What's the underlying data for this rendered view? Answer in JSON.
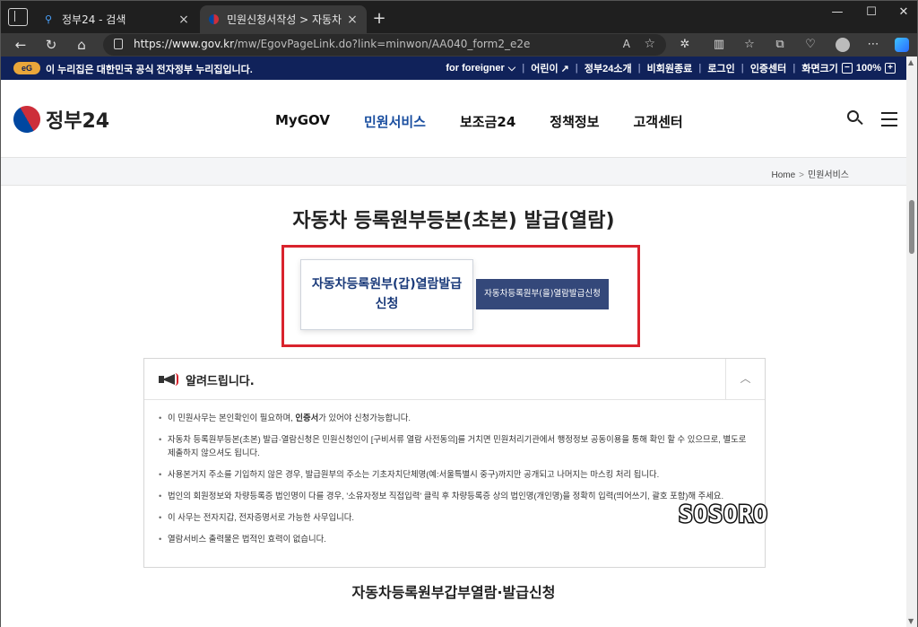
{
  "browser": {
    "tabs": [
      {
        "title": "정부24 - 검색",
        "favicon": "search-icon",
        "active": false
      },
      {
        "title": "민원신청서작성 > 자동차 등록원부",
        "favicon": "gov24-icon",
        "active": true
      }
    ],
    "new_tab": "+",
    "url_host": "https://www.gov.kr",
    "url_path": "/mw/EgovPageLink.do?link=minwon/AA040_form2_e2e",
    "read_aloud": "A",
    "window_controls": {
      "minimize": "—",
      "maximize": "☐",
      "close": "✕"
    }
  },
  "gov_banner": {
    "logo": "eG",
    "notice": "이 누리집은 대한민국 공식 전자정부 누리집입니다.",
    "links": [
      "for foreigner",
      "어린이",
      "정부24소개",
      "비회원종료",
      "로그인",
      "인증센터",
      "화면크기"
    ],
    "zoom": "100%",
    "zoom_minus": "−",
    "zoom_plus": "+"
  },
  "header": {
    "logo_text": "정부24",
    "nav": [
      "MyGOV",
      "민원서비스",
      "보조금24",
      "정책정보",
      "고객센터"
    ],
    "active_nav": "민원서비스"
  },
  "breadcrumb": {
    "home": "Home",
    "sep": ">",
    "current": "민원서비스"
  },
  "page": {
    "title": "자동차 등록원부등본(초본) 발급(열람)",
    "button_a": "자동차등록원부(갑)열람발급신청",
    "button_b": "자동차등록원부(을)열람발급신청"
  },
  "notice": {
    "title": "알려드립니다.",
    "collapse": "︿",
    "items": [
      {
        "pre": "이 민원사무는 본인확인이 필요하며, ",
        "bold": "인증서",
        "post": "가 있어야 신청가능합니다."
      },
      {
        "text": "자동차 등록원부등본(초본) 발급·열람신청은 민원신청인이 [구비서류 열람 사전동의]를 거치면 민원처리기관에서 행정정보 공동이용을 통해 확인 할 수 있으므로, 별도로 제출하지 않으셔도 됩니다."
      },
      {
        "text": "사용본거지 주소를 기입하지 않은 경우, 발급원부의 주소는 기초자치단체명(예:서울특별시 중구)까지만 공개되고 나머지는 마스킹 처리 됩니다."
      },
      {
        "text": "법인의 회원정보와 차량등록증 법인명이 다를 경우, '소유자정보 직접입력' 클릭 후 차량등록증 상의 법인명(개인명)을 정확히 입력(띄어쓰기, 괄호 포함)해 주세요."
      },
      {
        "text": "이 사무는 전자지갑, 전자증명서로 가능한 사무입니다."
      },
      {
        "text": "열람서비스 출력물은 법적인 효력이 없습니다."
      }
    ]
  },
  "watermark": "SOSORO",
  "section_title": "자동차등록원부갑부열람·발급신청",
  "colors": {
    "gov_navy": "#10225a",
    "accent_blue": "#1b4fa0",
    "highlight_red": "#d9232d",
    "button_navy": "#34487a"
  }
}
